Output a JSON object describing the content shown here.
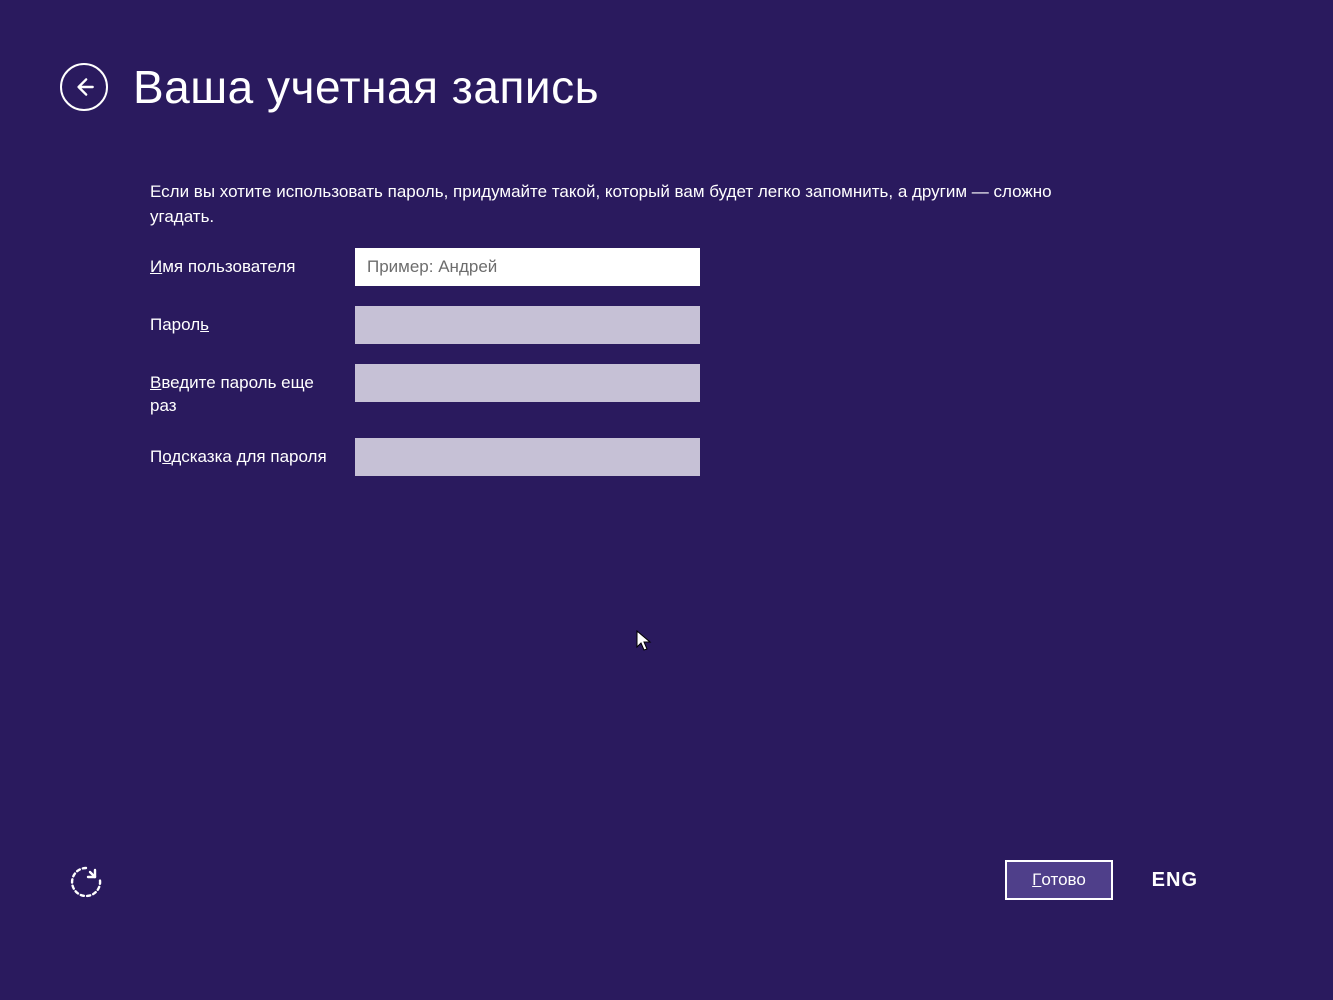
{
  "header": {
    "title": "Ваша учетная запись"
  },
  "description": "Если вы хотите использовать пароль, придумайте такой, который вам будет легко запомнить, а другим — сложно угадать.",
  "form": {
    "username": {
      "label_prefix": "И",
      "label_rest": "мя пользователя",
      "placeholder": "Пример: Андрей",
      "value": ""
    },
    "password": {
      "label_prefix": "Парол",
      "label_underlined": "ь",
      "value": ""
    },
    "reenter": {
      "label_underlined": "В",
      "label_rest": "ведите пароль еще раз",
      "value": ""
    },
    "hint": {
      "label_prefix": "П",
      "label_underlined": "о",
      "label_rest": "дсказка для пароля",
      "value": ""
    }
  },
  "footer": {
    "done_underlined": "Г",
    "done_rest": "отово",
    "language": "ENG"
  }
}
